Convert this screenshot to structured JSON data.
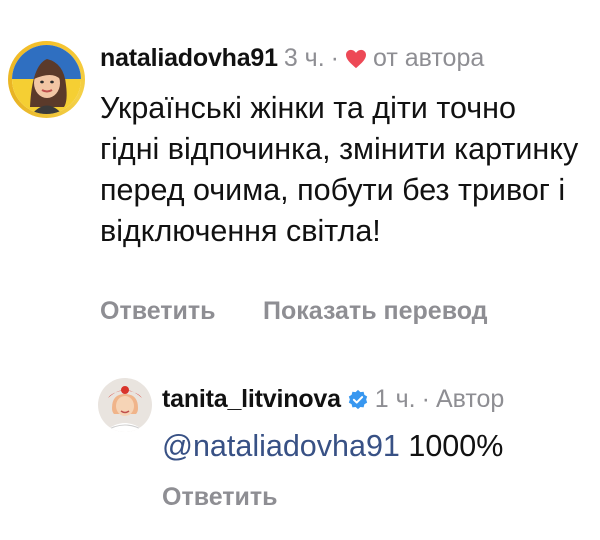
{
  "comment": {
    "username": "nataliadovha91",
    "time": "3 ч.",
    "separator": "·",
    "liked_label": "от автора",
    "text": "Українські жінки та діти точно гідні відпочинка, змінити картинку перед очима, побути без тривог і відключення світла!",
    "reply_label": "Ответить",
    "translate_label": "Показать перевод"
  },
  "reply": {
    "username": "tanita_litvinova",
    "time": "1 ч.",
    "separator": "·",
    "author_label": "Автор",
    "mention": "@nataliadovha91",
    "text": "1000%",
    "reply_label": "Ответить"
  },
  "colors": {
    "meta_gray": "#8e8e93",
    "mention_blue": "#385185",
    "heart_red": "#ed4956",
    "verified_blue": "#3897f0",
    "story_ring": "#f6c12b"
  }
}
